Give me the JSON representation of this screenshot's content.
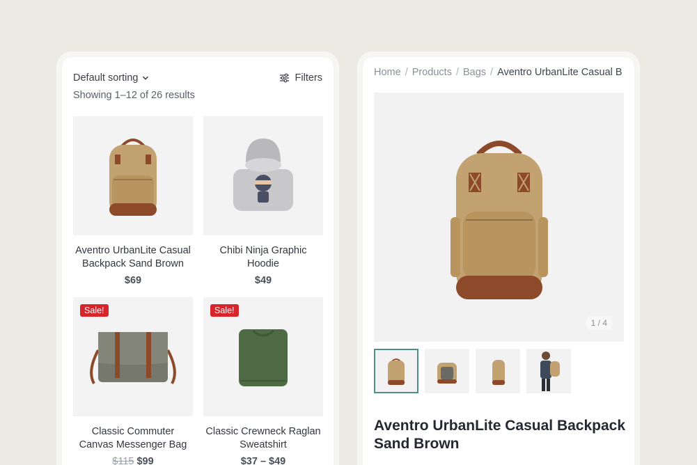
{
  "shop": {
    "sort_label": "Default sorting",
    "filters_label": "Filters",
    "results_text": "Showing 1–12 of 26 results",
    "products": [
      {
        "name": "Aventro UrbanLite Casual Backpack Sand Brown",
        "price": "$69",
        "old_price": "",
        "badge": ""
      },
      {
        "name": "Chibi Ninja Graphic Hoodie",
        "price": "$49",
        "old_price": "",
        "badge": ""
      },
      {
        "name": "Classic Commuter Canvas Messenger Bag",
        "price": "$99",
        "old_price": "$115",
        "badge": "Sale!"
      },
      {
        "name": "Classic Crewneck Raglan Sweatshirt",
        "price": "$37 – $49",
        "old_price": "",
        "badge": "Sale!"
      }
    ]
  },
  "product": {
    "breadcrumbs": [
      "Home",
      "Products",
      "Bags",
      "Aventro UrbanLite Casual B"
    ],
    "gallery_counter": "1 / 4",
    "title": "Aventro UrbanLite Casual Backpack Sand Brown"
  },
  "colors": {
    "background": "#ebebe4",
    "sale_badge": "#d6262c",
    "thumb_active_border": "#4f8f83",
    "backpack": "#c3a272",
    "backpack_trim": "#8c4a2a"
  }
}
